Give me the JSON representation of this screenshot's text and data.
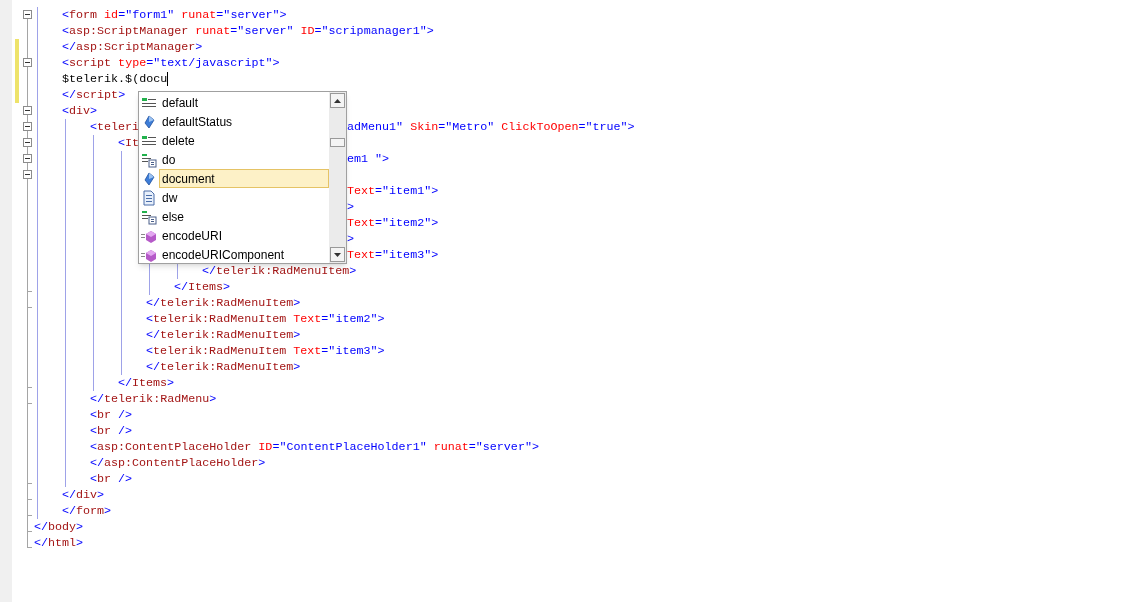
{
  "editor": {
    "lines": [
      {
        "collapsible": true,
        "tokens": [
          {
            "kind": "punct",
            "text": "    <"
          },
          {
            "kind": "tag",
            "text": "form"
          },
          {
            "kind": "attr",
            "text": " id"
          },
          {
            "kind": "punct",
            "text": "=\""
          },
          {
            "kind": "value",
            "text": "form1"
          },
          {
            "kind": "punct",
            "text": "\""
          },
          {
            "kind": "attr",
            "text": " runat"
          },
          {
            "kind": "punct",
            "text": "=\""
          },
          {
            "kind": "value",
            "text": "server"
          },
          {
            "kind": "punct",
            "text": "\">"
          }
        ]
      },
      {
        "tokens": [
          {
            "kind": "punct",
            "text": "    <"
          },
          {
            "kind": "tag",
            "text": "asp:ScriptManager"
          },
          {
            "kind": "attr",
            "text": " runat"
          },
          {
            "kind": "punct",
            "text": "=\""
          },
          {
            "kind": "value",
            "text": "server"
          },
          {
            "kind": "punct",
            "text": "\""
          },
          {
            "kind": "attr",
            "text": " ID"
          },
          {
            "kind": "punct",
            "text": "=\""
          },
          {
            "kind": "value",
            "text": "scripmanager1"
          },
          {
            "kind": "punct",
            "text": "\">"
          }
        ]
      },
      {
        "changed": true,
        "tokens": [
          {
            "kind": "punct",
            "text": "    </"
          },
          {
            "kind": "tag",
            "text": "asp:ScriptManager"
          },
          {
            "kind": "punct",
            "text": ">"
          }
        ]
      },
      {
        "changed": true,
        "collapsible": true,
        "tokens": [
          {
            "kind": "punct",
            "text": "    <"
          },
          {
            "kind": "tag",
            "text": "script"
          },
          {
            "kind": "attr",
            "text": " type"
          },
          {
            "kind": "punct",
            "text": "=\""
          },
          {
            "kind": "value",
            "text": "text/javascript"
          },
          {
            "kind": "punct",
            "text": "\">"
          }
        ]
      },
      {
        "changed": true,
        "caret": true,
        "tokens": [
          {
            "kind": "plain",
            "text": "    $telerik.$(docu"
          }
        ]
      },
      {
        "changed": true,
        "tokens": [
          {
            "kind": "punct",
            "text": "    </"
          },
          {
            "kind": "tag",
            "text": "script"
          },
          {
            "kind": "punct",
            "text": ">"
          }
        ]
      },
      {
        "collapsible": true,
        "tokens": [
          {
            "kind": "punct",
            "text": "    <"
          },
          {
            "kind": "tag",
            "text": "div"
          },
          {
            "kind": "punct",
            "text": ">"
          }
        ]
      },
      {
        "collapsible": true,
        "tokens": [
          {
            "kind": "punct",
            "text": "        <"
          },
          {
            "kind": "tag",
            "text": "teleri"
          }
        ],
        "after": [
          {
            "kind": "value",
            "text": "adMenu1"
          },
          {
            "kind": "punct",
            "text": "\""
          },
          {
            "kind": "attr",
            "text": " Skin"
          },
          {
            "kind": "punct",
            "text": "=\""
          },
          {
            "kind": "value",
            "text": "Metro"
          },
          {
            "kind": "punct",
            "text": "\""
          },
          {
            "kind": "attr",
            "text": " ClickToOpen"
          },
          {
            "kind": "punct",
            "text": "=\""
          },
          {
            "kind": "value",
            "text": "true"
          },
          {
            "kind": "punct",
            "text": "\">"
          }
        ]
      },
      {
        "collapsible": true,
        "tokens": [
          {
            "kind": "punct",
            "text": "            <"
          },
          {
            "kind": "tag",
            "text": "It"
          }
        ]
      },
      {
        "collapsible": true,
        "after": [
          {
            "kind": "value",
            "text": "em1 "
          },
          {
            "kind": "punct",
            "text": "\">"
          }
        ]
      },
      {
        "collapsible": true
      },
      {
        "after": [
          {
            "kind": "attr",
            "text": "Text"
          },
          {
            "kind": "punct",
            "text": "=\""
          },
          {
            "kind": "value",
            "text": "item1"
          },
          {
            "kind": "punct",
            "text": "\">"
          }
        ]
      },
      {
        "after": [
          {
            "kind": "punct",
            "text": ">"
          }
        ]
      },
      {
        "after": [
          {
            "kind": "attr",
            "text": "Text"
          },
          {
            "kind": "punct",
            "text": "=\""
          },
          {
            "kind": "value",
            "text": "item2"
          },
          {
            "kind": "punct",
            "text": "\">"
          }
        ]
      },
      {
        "after": [
          {
            "kind": "punct",
            "text": ">"
          }
        ]
      },
      {
        "after": [
          {
            "kind": "attr",
            "text": "Text"
          },
          {
            "kind": "punct",
            "text": "=\""
          },
          {
            "kind": "value",
            "text": "item3"
          },
          {
            "kind": "punct",
            "text": "\">"
          }
        ]
      },
      {
        "tokens": [
          {
            "kind": "punct",
            "text": "                        </"
          },
          {
            "kind": "tag",
            "text": "telerik:RadMenuItem"
          },
          {
            "kind": "punct",
            "text": ">"
          }
        ]
      },
      {
        "block_end": true,
        "tokens": [
          {
            "kind": "punct",
            "text": "                    </"
          },
          {
            "kind": "tag",
            "text": "Items"
          },
          {
            "kind": "punct",
            "text": ">"
          }
        ]
      },
      {
        "block_end": true,
        "tokens": [
          {
            "kind": "punct",
            "text": "                </"
          },
          {
            "kind": "tag",
            "text": "telerik:RadMenuItem"
          },
          {
            "kind": "punct",
            "text": ">"
          }
        ]
      },
      {
        "tokens": [
          {
            "kind": "punct",
            "text": "                <"
          },
          {
            "kind": "tag",
            "text": "telerik:RadMenuItem"
          },
          {
            "kind": "attr",
            "text": " Text"
          },
          {
            "kind": "punct",
            "text": "=\""
          },
          {
            "kind": "value",
            "text": "item2"
          },
          {
            "kind": "punct",
            "text": "\">"
          }
        ]
      },
      {
        "tokens": [
          {
            "kind": "punct",
            "text": "                </"
          },
          {
            "kind": "tag",
            "text": "telerik:RadMenuItem"
          },
          {
            "kind": "punct",
            "text": ">"
          }
        ]
      },
      {
        "tokens": [
          {
            "kind": "punct",
            "text": "                <"
          },
          {
            "kind": "tag",
            "text": "telerik:RadMenuItem"
          },
          {
            "kind": "attr",
            "text": " Text"
          },
          {
            "kind": "punct",
            "text": "=\""
          },
          {
            "kind": "value",
            "text": "item3"
          },
          {
            "kind": "punct",
            "text": "\">"
          }
        ]
      },
      {
        "tokens": [
          {
            "kind": "punct",
            "text": "                </"
          },
          {
            "kind": "tag",
            "text": "telerik:RadMenuItem"
          },
          {
            "kind": "punct",
            "text": ">"
          }
        ]
      },
      {
        "block_end": true,
        "tokens": [
          {
            "kind": "punct",
            "text": "            </"
          },
          {
            "kind": "tag",
            "text": "Items"
          },
          {
            "kind": "punct",
            "text": ">"
          }
        ]
      },
      {
        "block_end": true,
        "tokens": [
          {
            "kind": "punct",
            "text": "        </"
          },
          {
            "kind": "tag",
            "text": "telerik:RadMenu"
          },
          {
            "kind": "punct",
            "text": ">"
          }
        ]
      },
      {
        "tokens": [
          {
            "kind": "punct",
            "text": "        <"
          },
          {
            "kind": "tag",
            "text": "br"
          },
          {
            "kind": "punct",
            "text": " />"
          }
        ]
      },
      {
        "tokens": [
          {
            "kind": "punct",
            "text": "        <"
          },
          {
            "kind": "tag",
            "text": "br"
          },
          {
            "kind": "punct",
            "text": " />"
          }
        ]
      },
      {
        "tokens": [
          {
            "kind": "punct",
            "text": "        <"
          },
          {
            "kind": "tag",
            "text": "asp:ContentPlaceHolder"
          },
          {
            "kind": "attr",
            "text": " ID"
          },
          {
            "kind": "punct",
            "text": "=\""
          },
          {
            "kind": "value",
            "text": "ContentPlaceHolder1"
          },
          {
            "kind": "punct",
            "text": "\""
          },
          {
            "kind": "attr",
            "text": " runat"
          },
          {
            "kind": "punct",
            "text": "=\""
          },
          {
            "kind": "value",
            "text": "server"
          },
          {
            "kind": "punct",
            "text": "\">"
          }
        ]
      },
      {
        "tokens": [
          {
            "kind": "punct",
            "text": "        </"
          },
          {
            "kind": "tag",
            "text": "asp:ContentPlaceHolder"
          },
          {
            "kind": "punct",
            "text": ">"
          }
        ]
      },
      {
        "block_end": true,
        "tokens": [
          {
            "kind": "punct",
            "text": "        <"
          },
          {
            "kind": "tag",
            "text": "br"
          },
          {
            "kind": "punct",
            "text": " />"
          }
        ]
      },
      {
        "block_end": true,
        "tokens": [
          {
            "kind": "punct",
            "text": "    </"
          },
          {
            "kind": "tag",
            "text": "div"
          },
          {
            "kind": "punct",
            "text": ">"
          }
        ]
      },
      {
        "block_end": true,
        "tokens": [
          {
            "kind": "punct",
            "text": "    </"
          },
          {
            "kind": "tag",
            "text": "form"
          },
          {
            "kind": "punct",
            "text": ">"
          }
        ]
      },
      {
        "block_end": true,
        "tokens": [
          {
            "kind": "punct",
            "text": "</"
          },
          {
            "kind": "tag",
            "text": "body"
          },
          {
            "kind": "punct",
            "text": ">"
          }
        ]
      },
      {
        "block_end": true,
        "tokens": [
          {
            "kind": "punct",
            "text": "</"
          },
          {
            "kind": "tag",
            "text": "html"
          },
          {
            "kind": "punct",
            "text": ">"
          }
        ]
      }
    ]
  },
  "completion": {
    "items": [
      {
        "kind": "keyword",
        "label": "default",
        "selected": false
      },
      {
        "kind": "property",
        "label": "defaultStatus",
        "selected": false
      },
      {
        "kind": "keyword",
        "label": "delete",
        "selected": false
      },
      {
        "kind": "snippet",
        "label": "do",
        "selected": false
      },
      {
        "kind": "property",
        "label": "document",
        "selected": true
      },
      {
        "kind": "file",
        "label": "dw",
        "selected": false
      },
      {
        "kind": "snippet",
        "label": "else",
        "selected": false
      },
      {
        "kind": "method",
        "label": "encodeURI",
        "selected": false
      },
      {
        "kind": "method",
        "label": "encodeURIComponent",
        "selected": false
      }
    ]
  }
}
